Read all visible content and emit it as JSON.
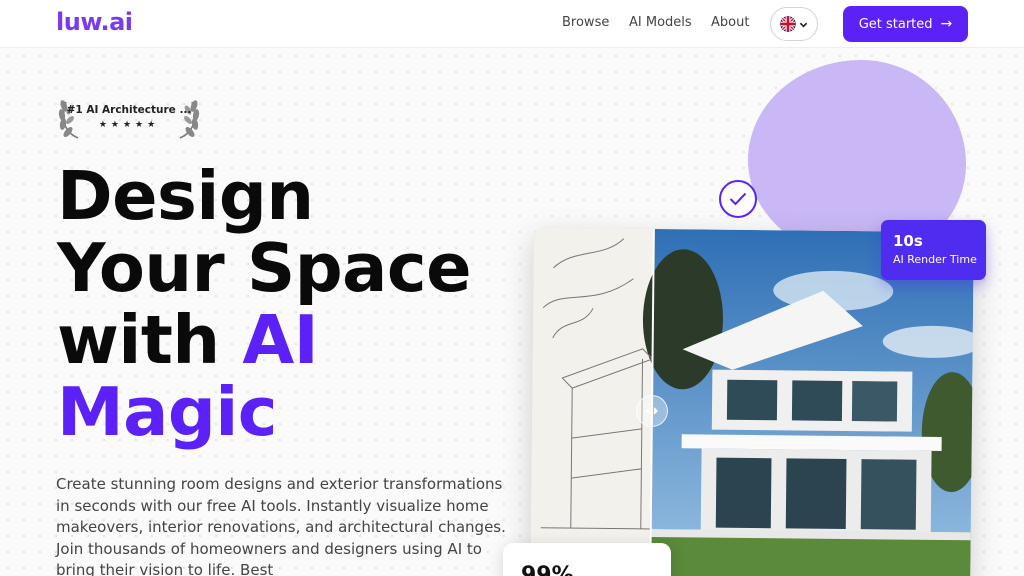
{
  "header": {
    "logo": "luw.ai",
    "nav": {
      "browse": "Browse",
      "ai_models": "AI Models",
      "about": "About"
    },
    "language": {
      "selected": "English (UK)",
      "icon": "uk-flag-icon"
    },
    "cta_label": "Get started",
    "cta_icon": "→"
  },
  "hero": {
    "badge": {
      "text": "#1 AI Architecture ...",
      "stars": "★★★★★"
    },
    "headline": {
      "line1": "Design",
      "line2": "Your Space",
      "line3_plain": "with ",
      "line3_accent": "AI",
      "line4_accent": "Magic"
    },
    "description": "Create stunning room designs and exterior transformations in seconds with our free AI tools. Instantly visualize home makeovers, interior renovations, and architectural changes. Join thousands of homeowners and designers using AI to bring their vision to life. Best",
    "stat_card": {
      "value": "10s",
      "label": "AI Render Time"
    },
    "bottom_card": {
      "value": "99%"
    }
  },
  "colors": {
    "brand": "#7c3aed",
    "primary": "#5b21f6",
    "blob": "#c9b8f5",
    "stat_card_bg": "#4f2cf0"
  }
}
